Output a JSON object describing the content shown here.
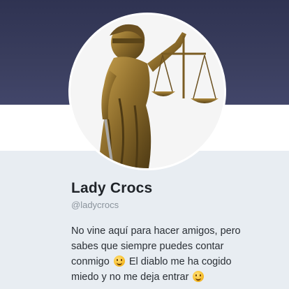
{
  "profile": {
    "name": "Lady Crocs",
    "handle": "@ladycrocs",
    "bio_lines": [
      "No vine aquí para hacer amigos, pero",
      "sabes que siempre puedes contar",
      "conmigo",
      "El diablo me ha cogido",
      "miedo y no me deja entrar"
    ],
    "avatar_icon": "lady-justice-statue-icon",
    "emoji_icons": [
      "grinning-face-emoji-icon",
      "smiling-face-emoji-icon"
    ]
  },
  "colors": {
    "banner": "#2f3352",
    "card_background": "#e8edf2",
    "name_text": "#1f2328",
    "handle_text": "#8a939c",
    "bronze": "#8a6a2a"
  }
}
